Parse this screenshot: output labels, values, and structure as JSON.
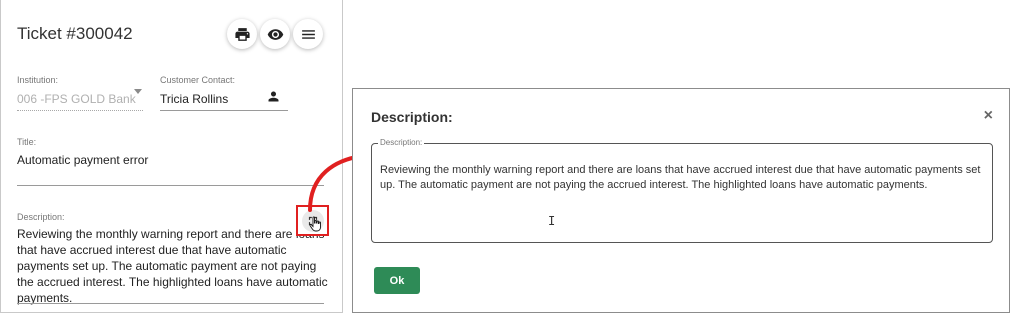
{
  "ticket": {
    "title": "Ticket #300042",
    "actions": {
      "print_icon": "print-icon",
      "view_icon": "eye-icon",
      "menu_icon": "menu-icon"
    },
    "institution": {
      "label": "Institution:",
      "value": "006 -FPS GOLD Bank"
    },
    "customer_contact": {
      "label": "Customer Contact:",
      "value": "Tricia Rollins"
    },
    "title_field": {
      "label": "Title:",
      "value": "Automatic payment error"
    },
    "description": {
      "label": "Description:",
      "value": "Reviewing the monthly warning report and there are loans that have accrued interest due that have automatic payments set up.  The automatic payment are not paying the accrued interest.  The highlighted loans have automatic payments."
    }
  },
  "modal": {
    "title": "Description:",
    "close_label": "×",
    "field_label": "Description:",
    "text": "Reviewing the monthly warning report and there are loans that have accrued interest due that have automatic payments set up.  The automatic payment are not paying the accrued interest.  The highlighted loans have automatic payments.",
    "ok_label": "Ok"
  },
  "colors": {
    "highlight": "#e02020",
    "ok_button": "#2e8b57"
  }
}
